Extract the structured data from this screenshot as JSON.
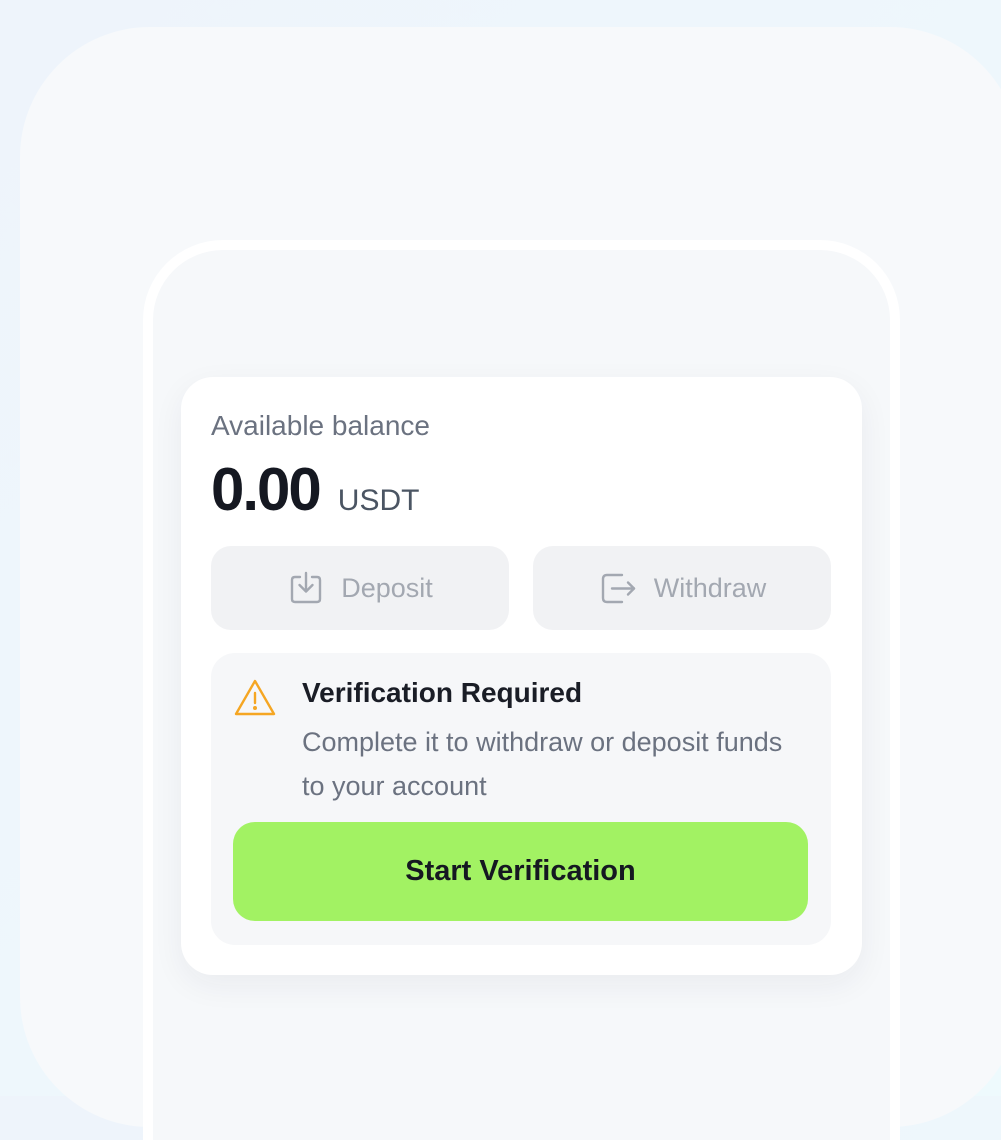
{
  "balance": {
    "label": "Available balance",
    "amount": "0.00",
    "currency": "USDT"
  },
  "actions": {
    "deposit_label": "Deposit",
    "withdraw_label": "Withdraw",
    "deposit_icon": "download-tray-icon",
    "withdraw_icon": "exit-arrow-icon"
  },
  "verification": {
    "title": "Verification Required",
    "description": "Complete it to withdraw or deposit funds to your account",
    "button_label": "Start Verification",
    "icon": "warning-triangle-icon"
  },
  "colors": {
    "accent": "#a2f263",
    "warning": "#f5a623",
    "disabled_text": "#a3a8b1",
    "disabled_bg": "#f1f2f4"
  }
}
